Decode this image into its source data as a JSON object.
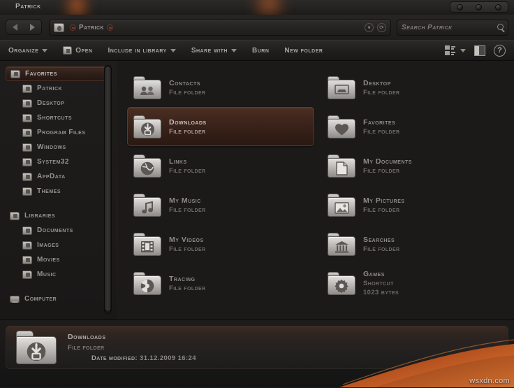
{
  "window": {
    "title": "Patrick",
    "controls": [
      "minimize-dot",
      "maximize-dot",
      "close-dot"
    ]
  },
  "nav": {
    "back_icon": "back-arrow-icon",
    "forward_icon": "forward-arrow-icon",
    "address": {
      "folder_icon": "user-folder-icon",
      "crumb": "Patrick",
      "dropdown_icon": "chevron-down-icon",
      "refresh_icon": "refresh-icon"
    },
    "search": {
      "placeholder": "Search Patrick",
      "value": "",
      "icon": "search-icon"
    }
  },
  "toolbar": {
    "items": [
      {
        "label": "Organize",
        "caret": true,
        "icon": ""
      },
      {
        "label": "Open",
        "caret": false,
        "icon": "open-folder-icon"
      },
      {
        "label": "Include in library",
        "caret": true,
        "icon": ""
      },
      {
        "label": "Share with",
        "caret": true,
        "icon": ""
      },
      {
        "label": "Burn",
        "caret": false,
        "icon": ""
      },
      {
        "label": "New folder",
        "caret": false,
        "icon": ""
      }
    ],
    "view_icon": "change-view-icon",
    "view_caret": true,
    "preview_icon": "preview-pane-icon",
    "help_icon": "help-icon",
    "help_glyph": "?"
  },
  "sidebar": {
    "groups": [
      {
        "header": {
          "label": "Favorites",
          "icon": "favorites-folder-icon",
          "active": true
        },
        "items": [
          {
            "label": "Patrick",
            "icon": "user-folder-icon"
          },
          {
            "label": "Desktop",
            "icon": "desktop-folder-icon"
          },
          {
            "label": "Shortcuts",
            "icon": "shortcuts-folder-icon"
          },
          {
            "label": "Program Files",
            "icon": "program-files-folder-icon"
          },
          {
            "label": "Windows",
            "icon": "windows-folder-icon"
          },
          {
            "label": "System32",
            "icon": "system32-folder-icon"
          },
          {
            "label": "AppData",
            "icon": "appdata-folder-icon"
          },
          {
            "label": "Themes",
            "icon": "themes-folder-icon"
          }
        ]
      },
      {
        "header": {
          "label": "Libraries",
          "icon": "libraries-folder-icon",
          "active": false
        },
        "items": [
          {
            "label": "Documents",
            "icon": "documents-folder-icon"
          },
          {
            "label": "Images",
            "icon": "images-folder-icon"
          },
          {
            "label": "Movies",
            "icon": "movies-folder-icon"
          },
          {
            "label": "Music",
            "icon": "music-folder-icon"
          }
        ]
      },
      {
        "header": {
          "label": "Computer",
          "icon": "computer-icon",
          "active": false
        },
        "items": []
      }
    ],
    "scrollbar": "sidebar-scrollbar"
  },
  "files": [
    {
      "name": "Contacts",
      "type": "File folder",
      "size": "",
      "icon": "contacts-folder-icon",
      "selected": false
    },
    {
      "name": "Desktop",
      "type": "File folder",
      "size": "",
      "icon": "desktop-folder-icon",
      "selected": false
    },
    {
      "name": "Downloads",
      "type": "File folder",
      "size": "",
      "icon": "downloads-folder-icon",
      "selected": true
    },
    {
      "name": "Favorites",
      "type": "File folder",
      "size": "",
      "icon": "favorites-folder-icon",
      "selected": false
    },
    {
      "name": "Links",
      "type": "File folder",
      "size": "",
      "icon": "links-folder-icon",
      "selected": false
    },
    {
      "name": "My Documents",
      "type": "File folder",
      "size": "",
      "icon": "documents-folder-icon",
      "selected": false
    },
    {
      "name": "My Music",
      "type": "File folder",
      "size": "",
      "icon": "music-folder-icon",
      "selected": false
    },
    {
      "name": "My Pictures",
      "type": "File folder",
      "size": "",
      "icon": "pictures-folder-icon",
      "selected": false
    },
    {
      "name": "My Videos",
      "type": "File folder",
      "size": "",
      "icon": "videos-folder-icon",
      "selected": false
    },
    {
      "name": "Searches",
      "type": "File folder",
      "size": "",
      "icon": "searches-folder-icon",
      "selected": false
    },
    {
      "name": "Tracing",
      "type": "File folder",
      "size": "",
      "icon": "tracing-folder-icon",
      "selected": false
    },
    {
      "name": "Games",
      "type": "Shortcut",
      "size": "1023 bytes",
      "icon": "games-folder-icon",
      "selected": false
    }
  ],
  "details": {
    "icon": "downloads-folder-icon",
    "name": "Downloads",
    "type": "File folder",
    "date_label": "Date modified:",
    "date_value": "31.12.2009 16:24"
  },
  "watermark": "wsxdn.com",
  "colors": {
    "accent": "#a8502a",
    "selection": "#4a2e22",
    "window_bg": "#1b1a19",
    "text": "#8f8b87"
  }
}
